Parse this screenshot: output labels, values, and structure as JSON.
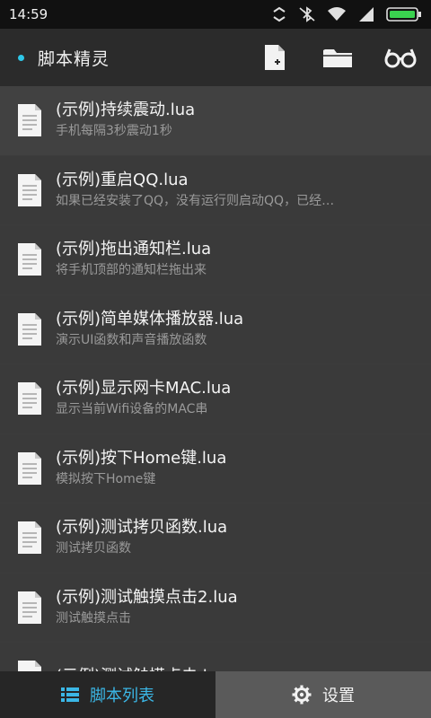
{
  "status": {
    "time": "14:59",
    "icons": [
      "sync-icon",
      "bluetooth-muted-icon",
      "wifi-icon",
      "signal-icon",
      "battery-icon"
    ]
  },
  "appbar": {
    "title": "脚本精灵",
    "accent": "#2ec7e8",
    "actions": [
      "new-file-icon",
      "folder-icon",
      "glasses-icon"
    ]
  },
  "scripts": [
    {
      "title": "(示例)持续震动.lua",
      "desc": "手机每隔3秒震动1秒"
    },
    {
      "title": "(示例)重启QQ.lua",
      "desc": "如果已经安装了QQ，没有运行则启动QQ，已经…"
    },
    {
      "title": "(示例)拖出通知栏.lua",
      "desc": "将手机顶部的通知栏拖出来"
    },
    {
      "title": "(示例)简单媒体播放器.lua",
      "desc": "演示UI函数和声音播放函数"
    },
    {
      "title": "(示例)显示网卡MAC.lua",
      "desc": "显示当前Wifi设备的MAC串"
    },
    {
      "title": "(示例)按下Home键.lua",
      "desc": "模拟按下Home键"
    },
    {
      "title": "(示例)测试拷贝函数.lua",
      "desc": "测试拷贝函数"
    },
    {
      "title": "(示例)测试触摸点击2.lua",
      "desc": "测试触摸点击"
    },
    {
      "title": "(示例)测试触摸点击.lua",
      "desc": ""
    }
  ],
  "tabs": {
    "list_label": "脚本列表",
    "settings_label": "设置",
    "active_color": "#3bb7e6"
  }
}
